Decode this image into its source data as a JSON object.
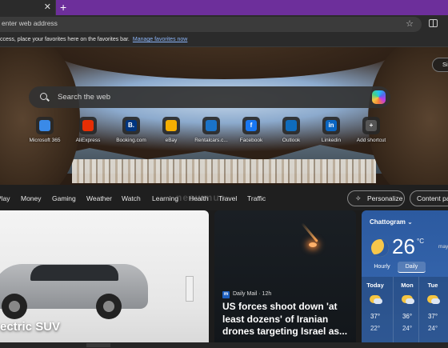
{
  "browser": {
    "tab_close": "✕",
    "new_tab": "+",
    "address_placeholder": "enter web address",
    "favorites_message": "ccess, place your favorites here on the favorites bar.",
    "favorites_link": "Manage favorites now"
  },
  "hero": {
    "signin_label": "Si",
    "search_placeholder": "Search the web",
    "shortcuts": [
      {
        "label": "Microsoft 365",
        "glyph": "",
        "color": "#3a8ae8"
      },
      {
        "label": "AliExpress",
        "glyph": "",
        "color": "#e62e04"
      },
      {
        "label": "Booking.com",
        "glyph": "B.",
        "color": "#003580"
      },
      {
        "label": "eBay",
        "glyph": "",
        "color": "#f5af02"
      },
      {
        "label": "Rentalcars.c...",
        "glyph": "",
        "color": "#1a73c8"
      },
      {
        "label": "Facebook",
        "glyph": "f",
        "color": "#1877f2"
      },
      {
        "label": "Outlook",
        "glyph": "",
        "color": "#0f6cbd"
      },
      {
        "label": "Linkedin",
        "glyph": "in",
        "color": "#0a66c2"
      },
      {
        "label": "Add shortcut",
        "glyph": "+",
        "color": "#555555"
      }
    ]
  },
  "nav": {
    "items": [
      "Play",
      "Money",
      "Gaming",
      "Weather",
      "Watch",
      "Learning",
      "Health",
      "Travel",
      "Traffic"
    ],
    "watermark": "neowmus",
    "personalize_label": "Personalize",
    "content_label": "Content pa"
  },
  "cards": {
    "car_title": "ectric SUV",
    "news_source": "Daily Mail · 12h",
    "news_source_logo": "m",
    "news_headline": "US forces shoot down 'at least dozens' of Iranian drones targeting Israel as..."
  },
  "weather": {
    "city": "Chattogram",
    "temp": "26",
    "unit": "°C",
    "rain": "may",
    "tabs": [
      "Hourly",
      "Daily"
    ],
    "days": [
      {
        "day": "Today",
        "hi": "37°",
        "lo": "22°"
      },
      {
        "day": "Mon",
        "hi": "36°",
        "lo": "24°"
      },
      {
        "day": "Tue",
        "hi": "37°",
        "lo": "24°"
      }
    ]
  }
}
